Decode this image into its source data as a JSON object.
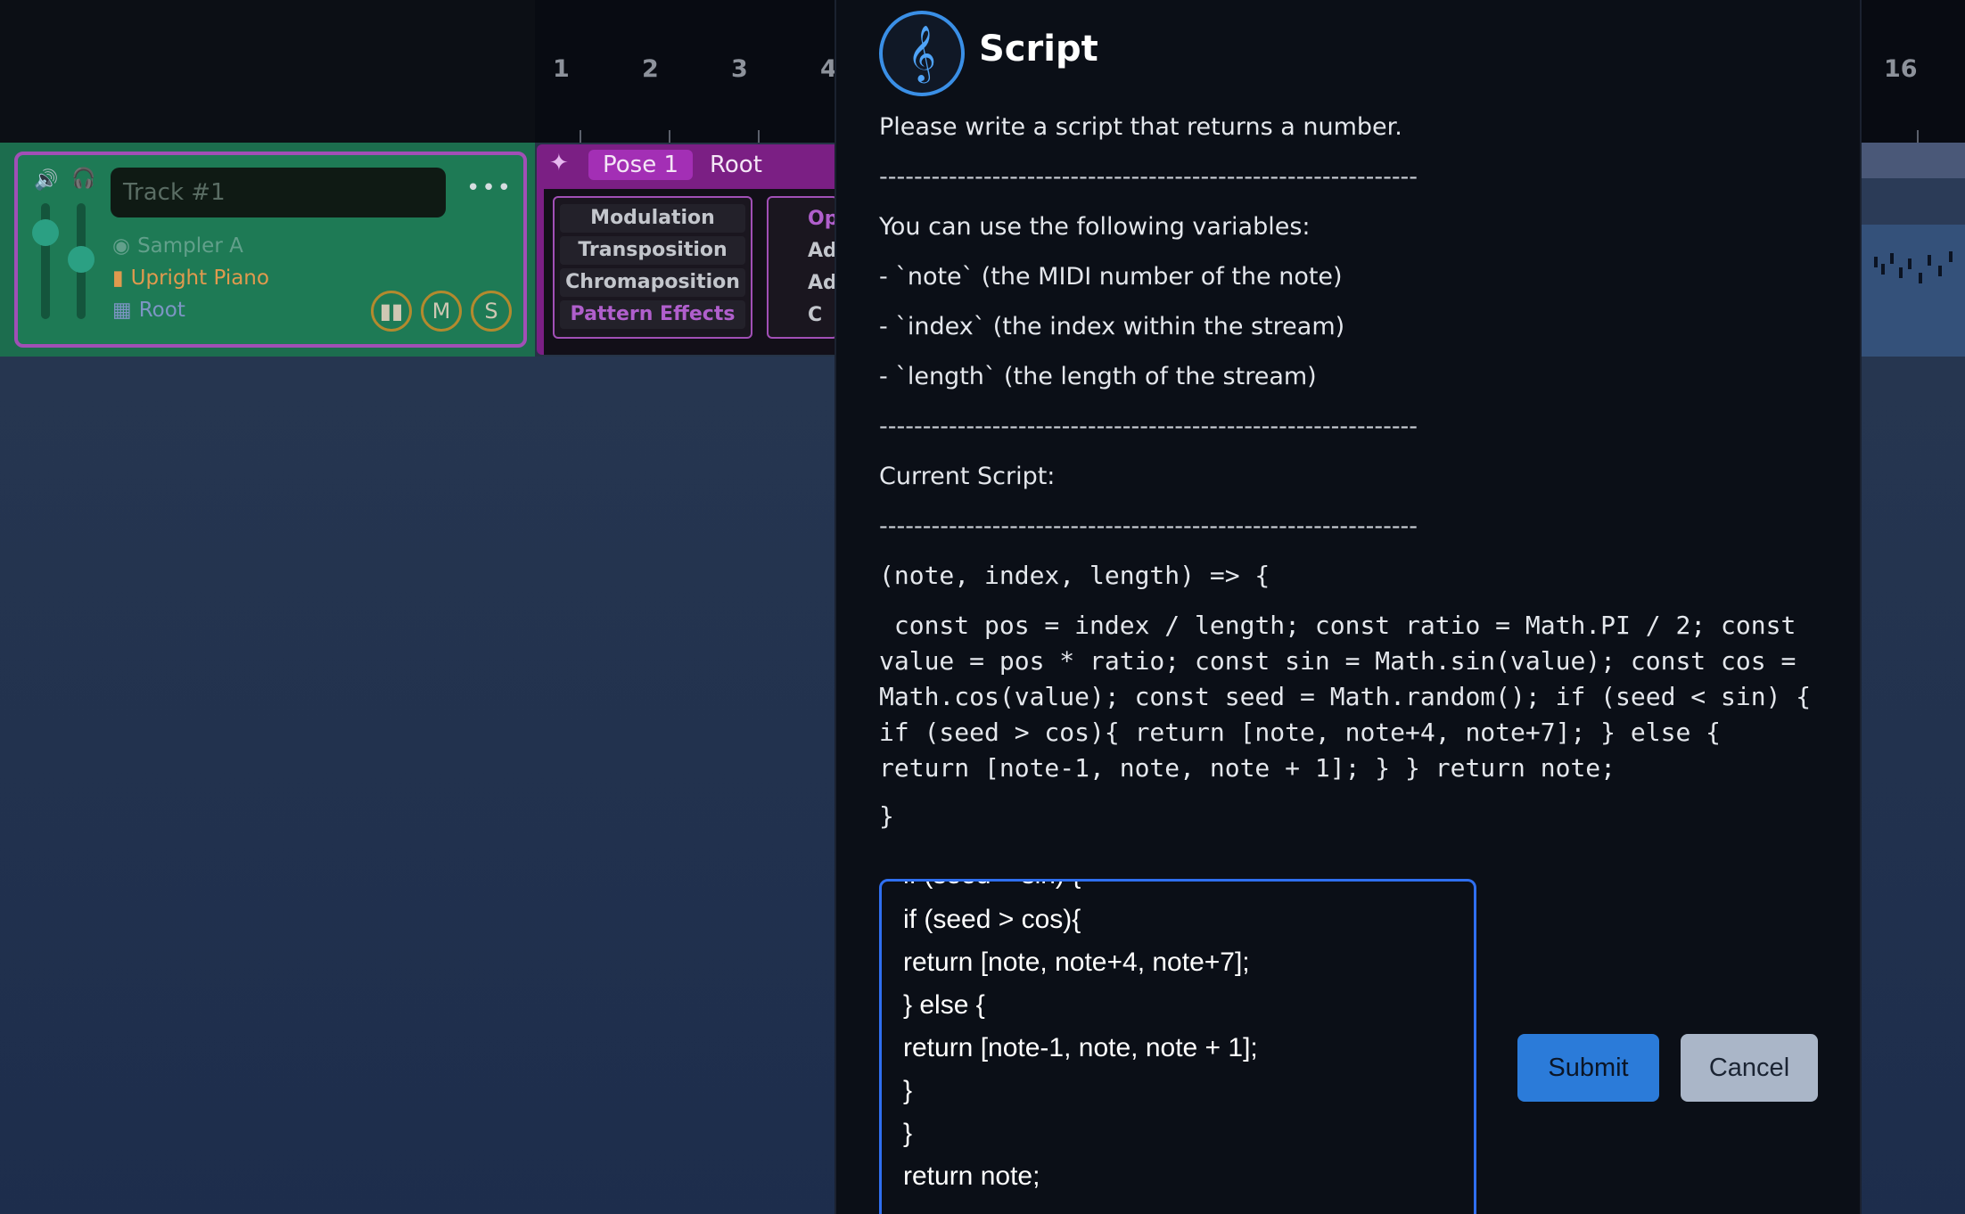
{
  "timeline": {
    "bars": [
      "1",
      "2",
      "3",
      "4",
      "16"
    ]
  },
  "track": {
    "name_placeholder": "Track #1",
    "menu_label": "•••",
    "sampler": "Sampler A",
    "instrument": "Upright Piano",
    "root": "Root",
    "mute_label": "M",
    "solo_label": "S"
  },
  "pattern": {
    "pose_label": "Pose 1",
    "root_label": "Root",
    "items": [
      "Modulation",
      "Transposition",
      "Chromaposition",
      "Pattern Effects"
    ],
    "items_right": [
      "Op",
      "Ad",
      "Ad",
      "C"
    ]
  },
  "dialog": {
    "title": "Script",
    "intro": "Please write a script that returns a number.",
    "separator": "--------------------------------------------------------------",
    "vars_heading": "You can use the following variables:",
    "var_note": "- `note` (the MIDI number of the note)",
    "var_index": "- `index` (the index within the stream)",
    "var_length": "- `length` (the length of the stream)",
    "current_label": "Current Script:",
    "code_open": "(note, index, length) => {",
    "code_body": " const pos = index / length; const ratio = Math.PI / 2; const value = pos * ratio; const sin = Math.sin(value); const cos = Math.cos(value); const seed = Math.random(); if (seed < sin) { if (seed > cos){ return [note, note+4, note+7]; } else { return [note-1, note, note + 1]; } } return note;",
    "code_close": "}",
    "editor_lines": [
      "if (seed < sin) {",
      "if (seed > cos){",
      "return [note, note+4, note+7];",
      "} else {",
      "return [note-1, note, note + 1];",
      "}",
      "}",
      "return note;"
    ],
    "submit_label": "Submit",
    "cancel_label": "Cancel"
  }
}
